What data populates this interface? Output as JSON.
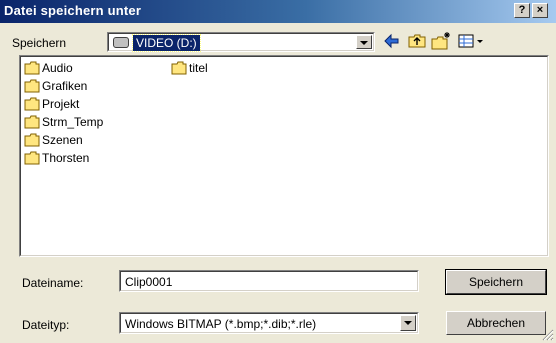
{
  "window": {
    "title": "Datei speichern unter",
    "help_label": "?",
    "close_label": "×"
  },
  "location": {
    "label": "Speichern",
    "value": "VIDEO (D:)"
  },
  "toolbar": {
    "back_icon": "back-arrow-icon",
    "up_icon": "up-folder-icon",
    "new_folder_icon": "new-folder-icon",
    "view_icon": "view-menu-icon"
  },
  "files": [
    {
      "name": "Audio"
    },
    {
      "name": "Grafiken"
    },
    {
      "name": "Projekt"
    },
    {
      "name": "Strm_Temp"
    },
    {
      "name": "Szenen"
    },
    {
      "name": "Thorsten"
    },
    {
      "name": "titel"
    }
  ],
  "filename": {
    "label": "Dateiname:",
    "value": "Clip0001"
  },
  "filetype": {
    "label": "Dateityp:",
    "value": "Windows BITMAP (*.bmp;*.dib;*.rle)"
  },
  "buttons": {
    "save": "Speichern",
    "cancel": "Abbrechen"
  }
}
